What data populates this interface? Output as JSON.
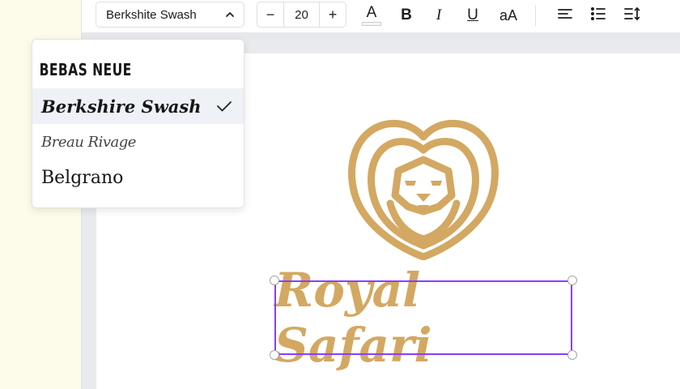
{
  "toolbar": {
    "font_name": "Berkshite Swash",
    "font_size": "20",
    "decrease_label": "−",
    "increase_label": "+",
    "bold_label": "B",
    "italic_label": "I",
    "underline_label": "U",
    "case_label": "aA",
    "text_color_label": "A",
    "icons": [
      "chevron-up-icon",
      "text-color-icon",
      "bold-icon",
      "italic-icon",
      "underline-icon",
      "letter-case-icon",
      "align-left-icon",
      "bulleted-list-icon",
      "line-spacing-icon"
    ]
  },
  "font_dropdown": {
    "items": [
      {
        "label": "BEBAS NEUE",
        "selected": false
      },
      {
        "label": "Berkshire Swash",
        "selected": true
      },
      {
        "label": "Breau Rivage",
        "selected": false
      },
      {
        "label": "Belgrano",
        "selected": false
      }
    ]
  },
  "canvas": {
    "text": "Royal Safari",
    "logo": "lion-logo",
    "accent_color": "#d3a862",
    "selection_color": "#8b3dff"
  }
}
